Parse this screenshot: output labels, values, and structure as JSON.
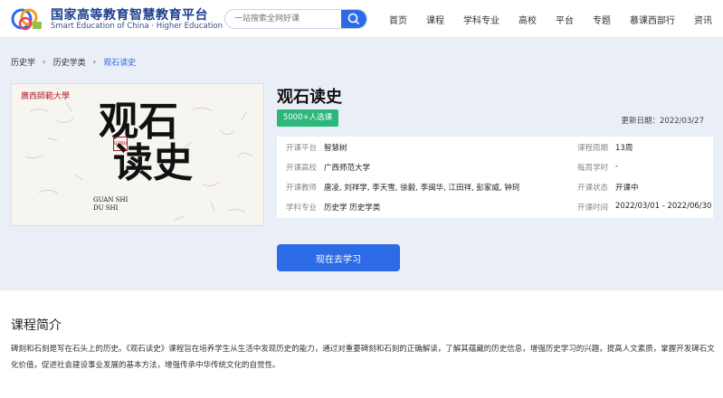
{
  "header": {
    "logo_cn": "国家高等教育智慧教育平台",
    "logo_en": "Smart Education of China · Higher Education",
    "search_placeholder": "一站搜索全网好课",
    "nav": [
      "首页",
      "课程",
      "学科专业",
      "高校",
      "平台",
      "专题",
      "慕课西部行",
      "资讯"
    ]
  },
  "breadcrumb": [
    "历史学",
    "历史学类",
    "观石读史"
  ],
  "cover": {
    "school": "廣西師範大學",
    "title_line1": "观石",
    "title_line2": "读史",
    "seal": "GXNU",
    "en_line1": "GUAN SHI",
    "en_line2": "DU SHI"
  },
  "course": {
    "title": "观石读史",
    "enroll_badge": "5000+人选课",
    "update_date": "更新日期：2022/03/27",
    "info": {
      "platform_label": "开课平台",
      "platform": "智慧树",
      "cycle_label": "课程周期",
      "cycle": "13周",
      "school_label": "开课高校",
      "school": "广西师范大学",
      "weekly_label": "每周学时",
      "weekly": "-",
      "teacher_label": "开课教师",
      "teachers": "唐凌, 刘祥学, 李天雪, 徐毅, 李闽华, 江田祥, 彭家威, 钟珂",
      "status_label": "开课状态",
      "status": "开课中",
      "major_label": "学科专业",
      "major": "历史学 历史学类",
      "time_label": "开课时间",
      "time": "2022/03/01 - 2022/06/30"
    },
    "study_button": "现在去学习"
  },
  "intro": {
    "heading": "课程简介",
    "text": "碑刻和石刻是写在石头上的历史。《观石读史》课程旨在培养学生从生活中发现历史的能力，通过对重要碑刻和石刻的正确解读，了解其蕴藏的历史信息，增强历史学习的兴趣，提高人文素质，掌握开发碑石文化价值，促进社会建设事业发展的基本方法，增强传承中华传统文化的自觉性。"
  },
  "colors": {
    "primary": "#2d6be6",
    "badge_green": "#2bb87a",
    "hero_bg": "#e9eef7"
  }
}
